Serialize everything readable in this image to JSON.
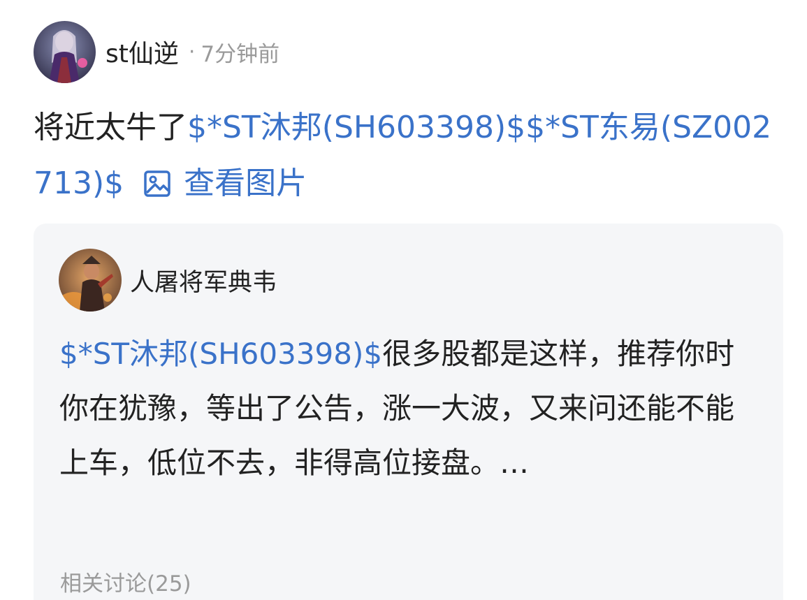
{
  "post": {
    "author": "st仙逆",
    "separator": "·",
    "time": "7分钟前",
    "text_prefix": "将近太牛了",
    "stock_1": "$*ST沐邦(SH603398)$",
    "stock_2": "$*ST东易(SZ002713)$",
    "view_image_label": "查看图片",
    "view_image_icon": "image-icon"
  },
  "quote": {
    "author": "人屠将军典韦",
    "stock": "$*ST沐邦(SH603398)$",
    "text": "很多股都是这样，推荐你时你在犹豫，等出了公告，涨一大波，又来问还能不能上车，低位不去，非得高位接盘。…",
    "related_label": "相关讨论(25)"
  },
  "colors": {
    "link": "#3a72c9",
    "text": "#222222",
    "muted": "#9a9a9a",
    "card_bg": "#f5f6f8"
  }
}
